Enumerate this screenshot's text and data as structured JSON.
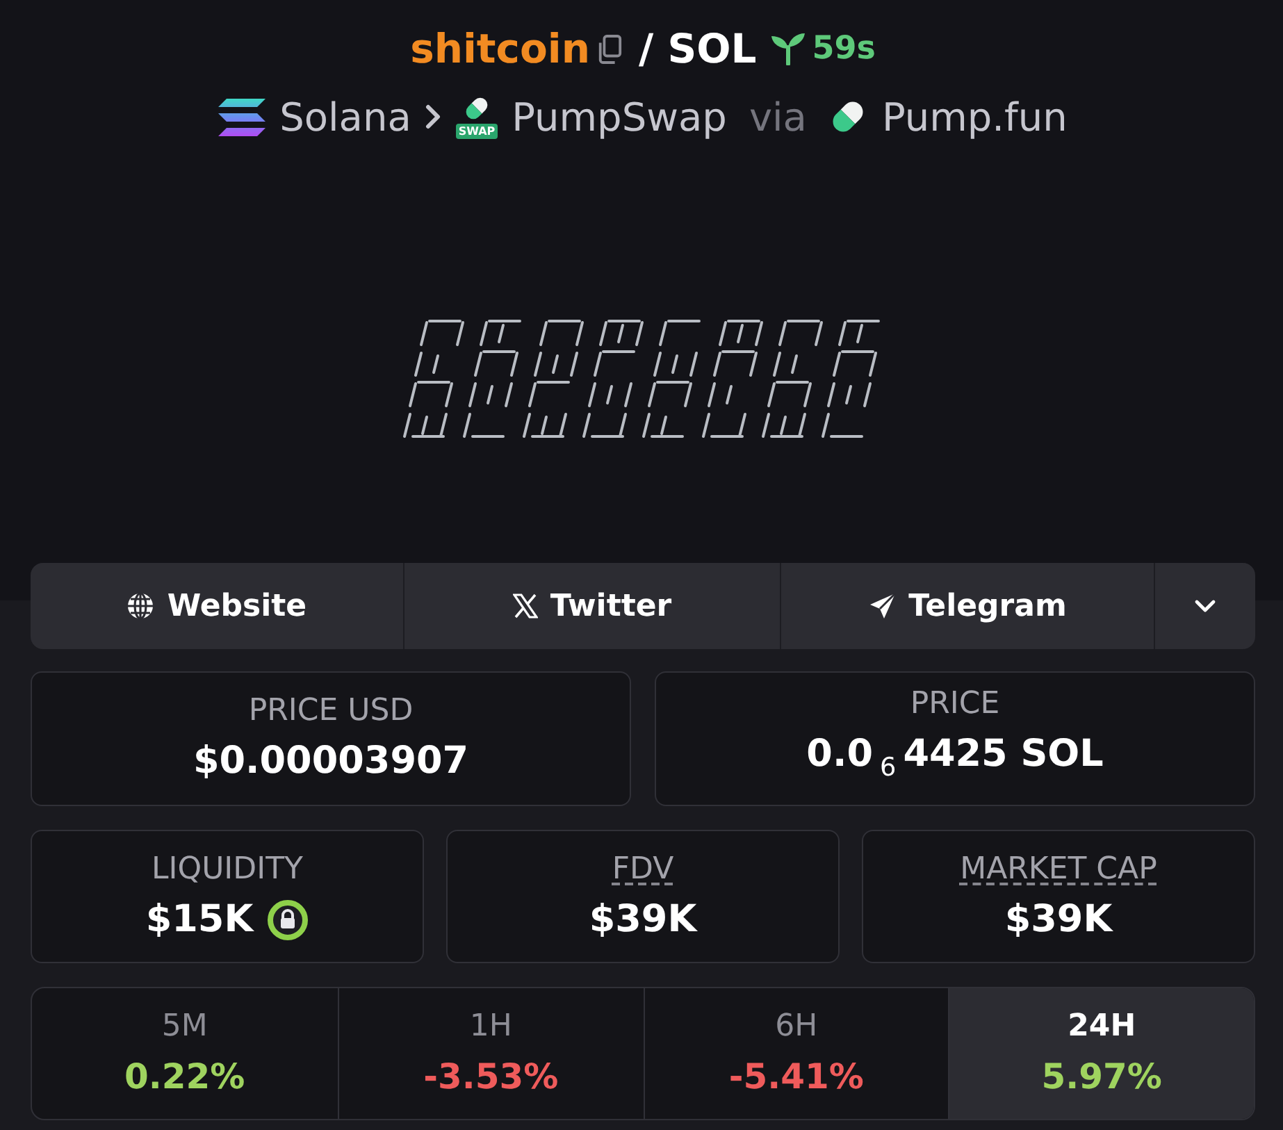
{
  "header": {
    "token": "shitcoin",
    "quote": "/ SOL",
    "age": "59s"
  },
  "breadcrumb": {
    "chain": "Solana",
    "dex": "PumpSwap",
    "dex_badge": "SWAP",
    "via": "via",
    "launchpad": "Pump.fun"
  },
  "links": [
    {
      "kind": "website",
      "label": "Website"
    },
    {
      "kind": "twitter",
      "label": "Twitter"
    },
    {
      "kind": "telegram",
      "label": "Telegram"
    },
    {
      "kind": "more"
    }
  ],
  "prices": [
    {
      "label": "PRICE USD",
      "value": "$0.00003907"
    },
    {
      "label": "PRICE",
      "value": "0.0$_{6}$4425 SOL"
    }
  ],
  "stats": [
    {
      "label": "LIQUIDITY",
      "value": "$15K",
      "locked": true,
      "underlined": false
    },
    {
      "label": "FDV",
      "value": "$39K",
      "locked": false,
      "underlined": true
    },
    {
      "label": "MARKET CAP",
      "value": "$39K",
      "locked": false,
      "underlined": true
    }
  ],
  "timeframes": [
    {
      "label": "5M",
      "change": "0.22%",
      "color": "#9fd35f",
      "selected": false
    },
    {
      "label": "1H",
      "change": "-3.53%",
      "color": "#ef5b5b",
      "selected": false
    },
    {
      "label": "6H",
      "change": "-5.41%",
      "color": "#ef5b5b",
      "selected": false
    },
    {
      "label": "24H",
      "change": "5.97%",
      "color": "#9fd35f",
      "selected": true
    }
  ]
}
